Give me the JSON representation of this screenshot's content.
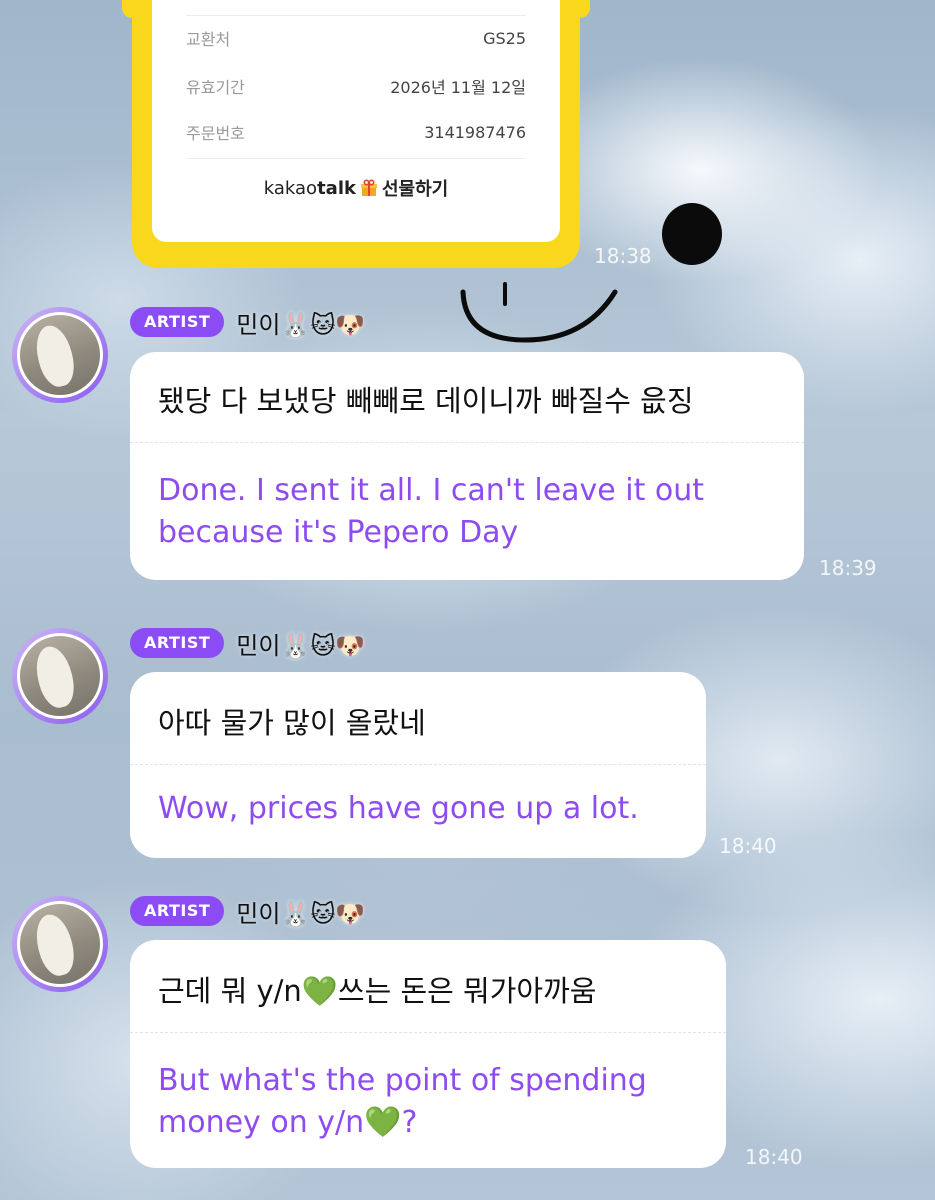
{
  "gift_card": {
    "rows": [
      {
        "label": "교환처",
        "value": "GS25"
      },
      {
        "label": "유효기간",
        "value": "2026년 11월 12일"
      },
      {
        "label": "주문번호",
        "value": "3141987476"
      }
    ],
    "brand_kakao": "kakao",
    "brand_talk": "talk",
    "brand_gift": "선물하기",
    "time": "18:38"
  },
  "messages": [
    {
      "badge": "ARTIST",
      "name": "민이🐰🐱🐶",
      "korean": "됐당 다 보냈당 빼빼로 데이니까 빠질수 읎징",
      "translation": "Done. I sent it all. I can't leave it out because it's Pepero Day",
      "time": "18:39"
    },
    {
      "badge": "ARTIST",
      "name": "민이🐰🐱🐶",
      "korean": "아따 물가 많이 올랐네",
      "translation": "Wow, prices have gone up a lot.",
      "time": "18:40"
    },
    {
      "badge": "ARTIST",
      "name": "민이🐰🐱🐶",
      "korean": "근데 뭐 y/n💚쓰는 돈은 뭐가아까움",
      "translation": "But what's the point of spending money on y/n💚?",
      "time": "18:40"
    }
  ],
  "colors": {
    "badge": "#8b4cf5",
    "translation_text": "#8e4cf0",
    "gift_card_frame": "#f9d71c"
  }
}
